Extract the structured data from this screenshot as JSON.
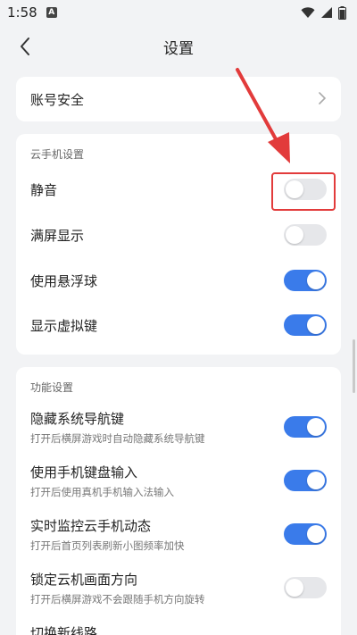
{
  "status_bar": {
    "time": "1:58",
    "notif_letter": "A"
  },
  "header": {
    "title": "设置"
  },
  "account": {
    "label": "账号安全"
  },
  "cloud_section": {
    "title": "云手机设置",
    "items": [
      {
        "label": "静音",
        "state": "off"
      },
      {
        "label": "满屏显示",
        "state": "off"
      },
      {
        "label": "使用悬浮球",
        "state": "on"
      },
      {
        "label": "显示虚拟键",
        "state": "on"
      }
    ]
  },
  "func_section": {
    "title": "功能设置",
    "items": [
      {
        "label": "隐藏系统导航键",
        "sub": "打开后横屏游戏时自动隐藏系统导航键",
        "state": "on"
      },
      {
        "label": "使用手机键盘输入",
        "sub": "打开后使用真机手机输入法输入",
        "state": "on"
      },
      {
        "label": "实时监控云手机动态",
        "sub": "打开后首页列表刷新小图频率加快",
        "state": "on"
      },
      {
        "label": "锁定云机画面方向",
        "sub": "打开后横屏游戏不会跟随手机方向旋转",
        "state": "off"
      },
      {
        "label": "切换新线路",
        "sub": "",
        "state": "off"
      }
    ]
  },
  "colors": {
    "accent": "#3a7bea",
    "annotation": "#e23b3b",
    "background": "#f2f3f5"
  }
}
